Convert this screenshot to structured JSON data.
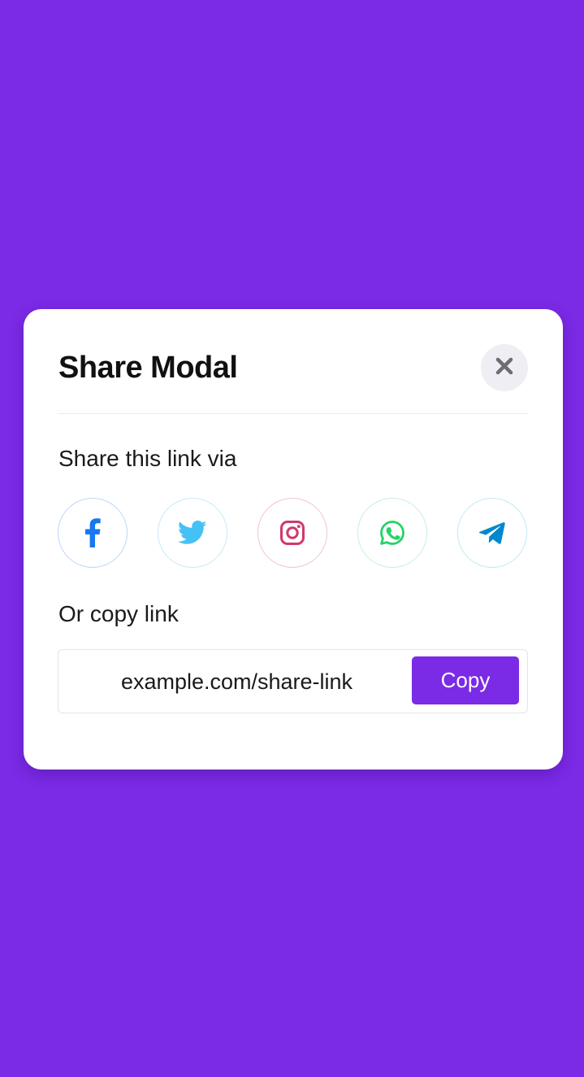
{
  "modal": {
    "title": "Share Modal",
    "share_label": "Share this link via",
    "copy_label": "Or copy link",
    "link_value": "example.com/share-link",
    "copy_button_label": "Copy"
  },
  "social": [
    {
      "name": "facebook",
      "icon": "facebook-icon",
      "color": "#1877f2",
      "border": "#bcd8f7"
    },
    {
      "name": "twitter",
      "icon": "twitter-icon",
      "color": "#46c1f6",
      "border": "#c4ebf7"
    },
    {
      "name": "instagram",
      "icon": "instagram-icon",
      "color": "#d1386c",
      "border": "#f3c2d2"
    },
    {
      "name": "whatsapp",
      "icon": "whatsapp-icon",
      "color": "#25d366",
      "border": "#c6f0d9"
    },
    {
      "name": "telegram",
      "icon": "telegram-icon",
      "color": "#0088cc",
      "border": "#c1e9f5"
    }
  ],
  "colors": {
    "background": "#7b2ae6",
    "accent": "#7b2ae6",
    "close_bg": "#eeeef4"
  }
}
